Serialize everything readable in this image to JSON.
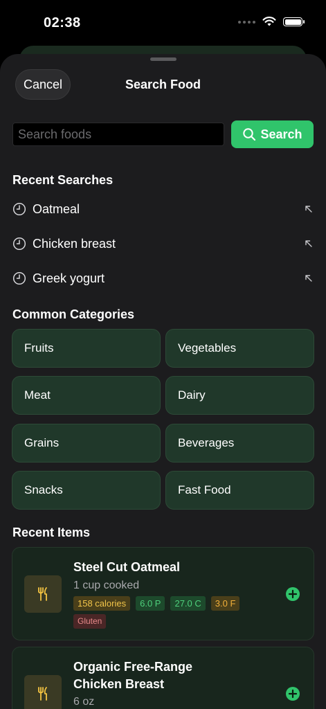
{
  "status": {
    "time": "02:38"
  },
  "sheet": {
    "title": "Search Food",
    "cancel_label": "Cancel"
  },
  "search": {
    "placeholder": "Search foods",
    "value": "",
    "button_label": "Search"
  },
  "recent_searches": {
    "title": "Recent Searches",
    "items": [
      "Oatmeal",
      "Chicken breast",
      "Greek yogurt"
    ]
  },
  "categories": {
    "title": "Common Categories",
    "items": [
      "Fruits",
      "Vegetables",
      "Meat",
      "Dairy",
      "Grains",
      "Beverages",
      "Snacks",
      "Fast Food"
    ]
  },
  "recent_items": {
    "title": "Recent Items",
    "items": [
      {
        "name": "Steel Cut Oatmeal",
        "serving": "1 cup cooked",
        "calories": "158 calories",
        "protein": "6.0 P",
        "carbs": "27.0 C",
        "fat": "3.0 F",
        "allergen": "Gluten"
      },
      {
        "name_line1": "Organic Free-Range",
        "name_line2": "Chicken Breast",
        "serving": "6 oz"
      }
    ]
  },
  "colors": {
    "accent": "#30c46b",
    "sheet_bg": "#1c1c1e",
    "category_bg": "#20382a",
    "card_bg": "#18261d",
    "calorie_tag": "#f2c54a",
    "macro_tag": "#4ed07c",
    "allergen_tag": "#e88a8a"
  },
  "icons": {
    "status": [
      "signal-dots-icon",
      "wifi-icon",
      "battery-icon"
    ],
    "search": "magnifier-icon",
    "recent": "clock-icon",
    "fill": "arrow-up-left-icon",
    "food": "fork-knife-icon",
    "add": "plus-circle-icon"
  }
}
